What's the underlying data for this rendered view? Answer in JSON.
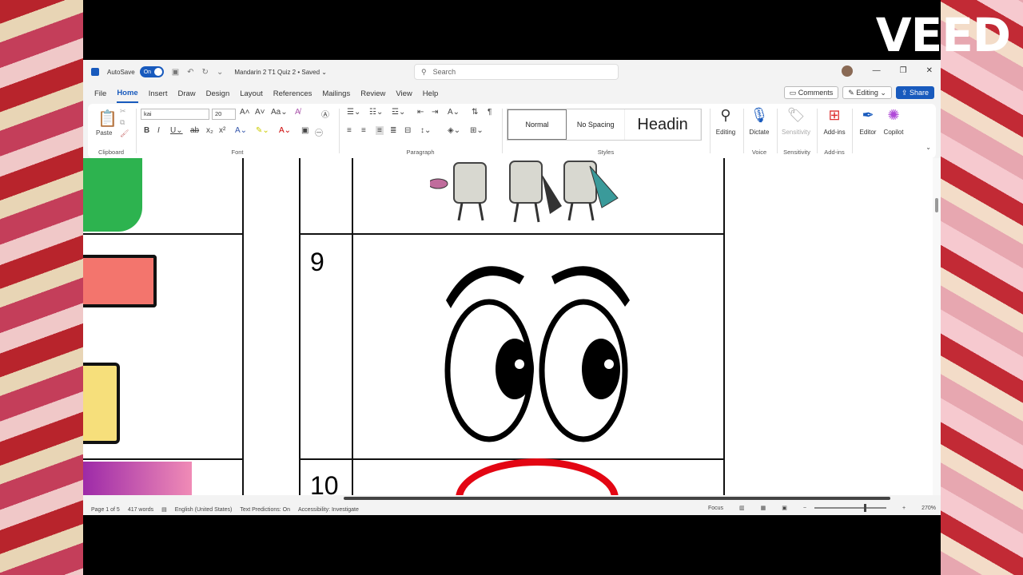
{
  "watermark": "VEED",
  "titlebar": {
    "autosave_label": "AutoSave",
    "toggle_label": "On",
    "doc_title": "Mandarin 2 T1 Quiz 2 • Saved ⌄",
    "search_placeholder": "Search"
  },
  "menu": {
    "items": [
      "File",
      "Home",
      "Insert",
      "Draw",
      "Design",
      "Layout",
      "References",
      "Mailings",
      "Review",
      "View",
      "Help"
    ],
    "active": "Home",
    "comments": "Comments",
    "editing": "Editing",
    "share": "Share"
  },
  "ribbon": {
    "clipboard": {
      "paste": "Paste",
      "label": "Clipboard"
    },
    "font": {
      "name": "kai",
      "size": "20",
      "label": "Font"
    },
    "paragraph": {
      "label": "Paragraph"
    },
    "styles": {
      "normal": "Normal",
      "no_spacing": "No Spacing",
      "heading": "Headin",
      "label": "Styles"
    },
    "editing": {
      "label": "Editing"
    },
    "voice": {
      "dictate": "Dictate",
      "label": "Voice"
    },
    "sensitivity": {
      "btn": "Sensitivity",
      "label": "Sensitivity"
    },
    "addins": {
      "btn": "Add-ins",
      "label": "Add-ins"
    },
    "editor": "Editor",
    "copilot": "Copilot"
  },
  "document": {
    "row9": "9",
    "row10": "10"
  },
  "status": {
    "page": "Page 1 of 5",
    "words": "417 words",
    "language": "English (United States)",
    "predictions": "Text Predictions: On",
    "accessibility": "Accessibility: Investigate",
    "focus": "Focus",
    "zoom": "270%"
  }
}
